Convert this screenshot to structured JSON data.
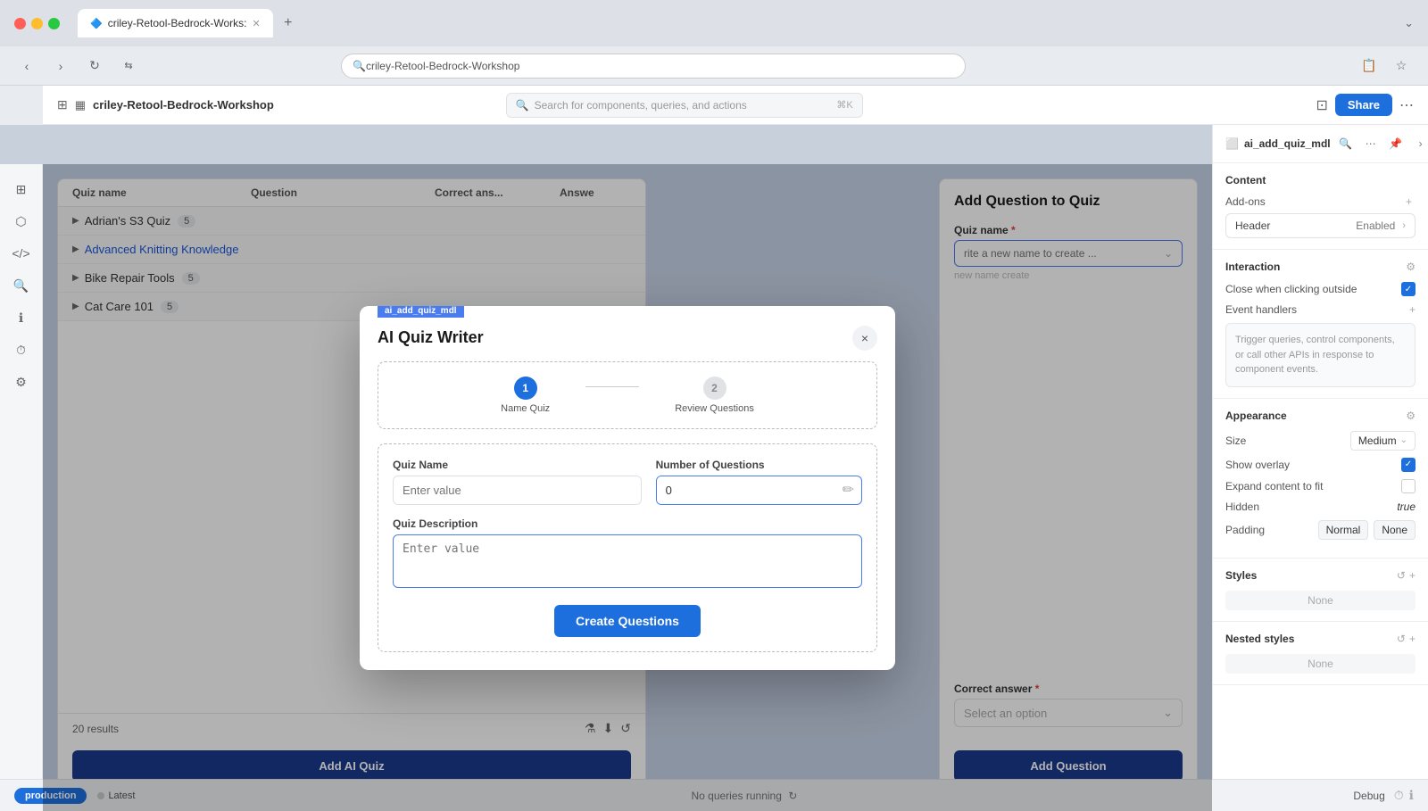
{
  "browser": {
    "tab_label": "criley-Retool-Bedrock-Works:",
    "address": "Search for components, queries, and actions",
    "address_shortcut": "⌘K"
  },
  "app": {
    "title": "criley-Retool-Bedrock-Workshop",
    "share_label": "Share"
  },
  "table": {
    "columns": [
      "Quiz name",
      "Question",
      "Correct ans...",
      "Answe"
    ],
    "groups": [
      {
        "name": "Adrian's S3 Quiz",
        "count": "5",
        "expanded": false
      },
      {
        "name": "Advanced Knitting Knowledge",
        "count": "",
        "expanded": false,
        "highlighted": true
      },
      {
        "name": "Bike Repair Tools",
        "count": "5",
        "expanded": false
      },
      {
        "name": "Cat Care 101",
        "count": "5",
        "expanded": false
      }
    ],
    "results_count": "20 results",
    "add_quiz_label": "Add AI Quiz"
  },
  "right_panel": {
    "title": "Add Question to Quiz",
    "quiz_name_label": "Quiz name",
    "quiz_name_required": "*",
    "quiz_name_placeholder": "rite a new name to create ...",
    "correct_answer_label": "Correct answer",
    "correct_answer_required": "*",
    "correct_answer_placeholder": "Select an option",
    "add_question_label": "Add Question"
  },
  "modal": {
    "tag": "ai_add_quiz_mdl",
    "title": "AI Quiz Writer",
    "close_label": "×",
    "step1_number": "1",
    "step1_label": "Name Quiz",
    "step2_number": "2",
    "step2_label": "Review Questions",
    "quiz_name_label": "Quiz Name",
    "quiz_name_placeholder": "Enter value",
    "number_label": "Number of Questions",
    "number_value": "0",
    "description_label": "Quiz Description",
    "description_placeholder": "Enter value",
    "create_btn_label": "Create Questions"
  },
  "props_panel": {
    "component_name": "ai_add_quiz_mdl",
    "content_section": "Content",
    "addons_label": "Add-ons",
    "header_label": "Header",
    "header_value": "Enabled",
    "interaction_section": "Interaction",
    "close_outside_label": "Close when clicking outside",
    "close_outside_value": true,
    "event_handlers_label": "Event handlers",
    "event_handlers_placeholder": "Trigger queries, control components, or call other APIs in response to component events.",
    "appearance_section": "Appearance",
    "size_label": "Size",
    "size_value": "Medium",
    "show_overlay_label": "Show overlay",
    "show_overlay_value": true,
    "expand_content_label": "Expand content to fit",
    "expand_content_value": false,
    "hidden_label": "Hidden",
    "hidden_value": "true",
    "padding_label": "Padding",
    "padding_value1": "Normal",
    "padding_value2": "None",
    "styles_section": "Styles",
    "styles_none": "None",
    "nested_styles_section": "Nested styles",
    "nested_styles_none": "None"
  },
  "bottom_bar": {
    "env_label": "production",
    "latest_label": "Latest",
    "no_queries_label": "No queries running",
    "debug_label": "Debug"
  }
}
